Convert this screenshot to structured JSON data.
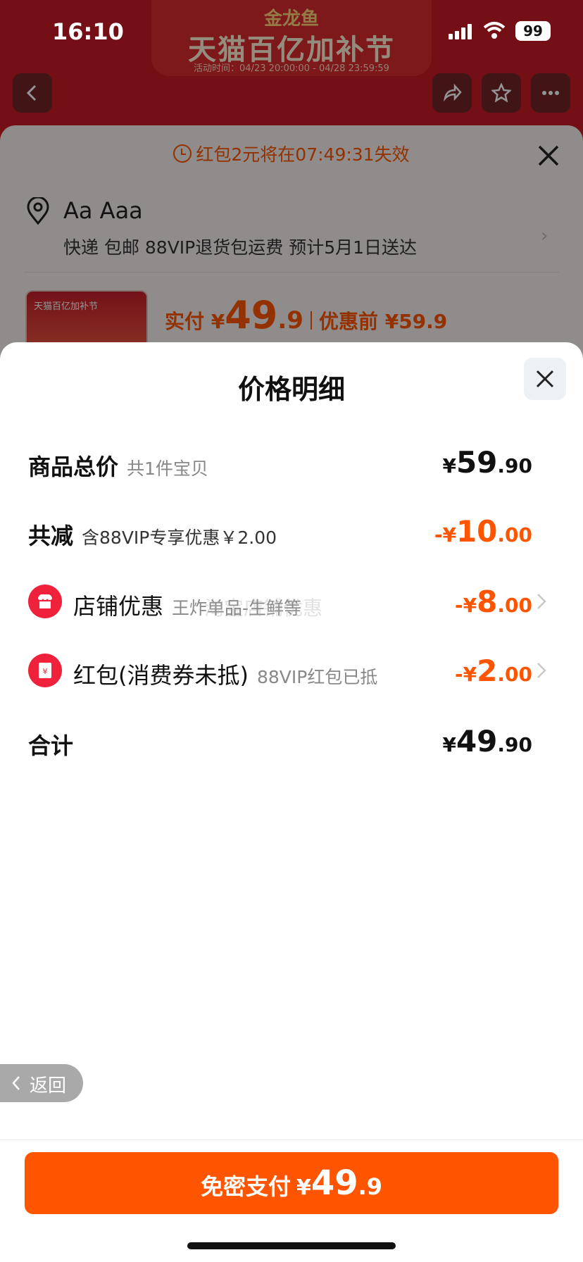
{
  "status_bar": {
    "time": "16:10",
    "battery": "99"
  },
  "banner": {
    "brand": "金龙鱼",
    "title": "天猫百亿加补节",
    "time_range": "活动时间：04/23 20:00:00 - 04/28 23:59:59"
  },
  "background": {
    "timer_text": "红包2元将在07:49:31失效",
    "address_name": "Aa Aaa",
    "address_detail": "快递 包邮 88VIP退货包运费 预计5月1日送达",
    "product_thumb_text": "天猫百亿加补节",
    "price_label": "实付 ¥",
    "price_int": "49",
    "price_dec": ".9",
    "pre_discount": "优惠前 ¥59.9"
  },
  "modal": {
    "title": "价格明细",
    "rows": {
      "total": {
        "label": "商品总价",
        "sub": "共1件宝贝",
        "cur": "¥",
        "int": "59",
        "dec": ".90"
      },
      "reduce": {
        "label": "共减",
        "sub": "含88VIP专享优惠￥2.00",
        "cur": "-¥",
        "int": "10",
        "dec": ".00"
      },
      "store": {
        "label": "店铺优惠",
        "sub": "王炸单品-生鲜等",
        "cur": "-¥",
        "int": "8",
        "dec": ".00"
      },
      "redpacket": {
        "label": "红包(消费券未抵)",
        "sub": "88VIP红包已抵",
        "cur": "-¥",
        "int": "2",
        "dec": ".00"
      },
      "sum": {
        "label": "合计",
        "cur": "¥",
        "int": "49",
        "dec": ".90"
      }
    },
    "watermark": "淘宝店铺优惠"
  },
  "back_button": "返回",
  "pay_button": {
    "label": "免密支付",
    "cur": "¥",
    "int": "49",
    "dec": ".9"
  },
  "colors": {
    "accent": "#ff5500",
    "icon_red": "#f0213a"
  }
}
